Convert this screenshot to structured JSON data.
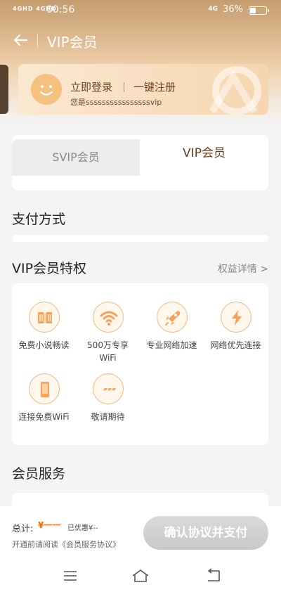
{
  "status": {
    "signal": "4GHD 4GHD",
    "time": "00:56",
    "network": "4G",
    "battery": "36%",
    "battery_level": 0.36
  },
  "nav": {
    "title": "VIP会员"
  },
  "login": {
    "login_label": "立即登录",
    "register_label": "一键注册",
    "subtitle": "您是ssssssssssssssssvip"
  },
  "tabs": [
    {
      "label": "SVIP会员",
      "active": false
    },
    {
      "label": "VIP会员",
      "active": true
    }
  ],
  "payment": {
    "title": "支付方式"
  },
  "perks": {
    "title": "VIP会员特权",
    "detail_label": "权益详情 >",
    "items": [
      {
        "label": "免费小说畅读",
        "icon": "book-icon"
      },
      {
        "label": "500万专享 WiFi",
        "icon": "wifi-icon"
      },
      {
        "label": "专业网络加速",
        "icon": "rocket-icon"
      },
      {
        "label": "网络优先连接",
        "icon": "lightning-icon"
      },
      {
        "label": "连接免费WiFi",
        "icon": "phone-icon"
      },
      {
        "label": "敬请期待",
        "icon": "more-icon"
      }
    ]
  },
  "services": {
    "title": "会员服务"
  },
  "checkout": {
    "total_label": "总计:",
    "total_price": "¥一一",
    "discount": "已优惠¥--",
    "agreement_text": "开通前请阅读《会员服务协议》",
    "pay_button": "确认协议并支付"
  },
  "colors": {
    "accent": "#f0b884",
    "brand_brown": "#6b3f1d",
    "price": "#ff6a00"
  }
}
